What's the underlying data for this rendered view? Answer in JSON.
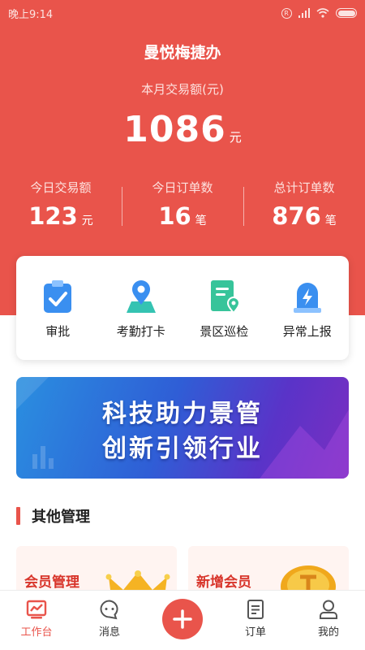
{
  "status_bar": {
    "time": "晚上9:14"
  },
  "header": {
    "store_name": "曼悦梅捷办",
    "month_label": "本月交易额(元)",
    "month_amount": "1086",
    "month_unit": "元"
  },
  "stats": [
    {
      "label": "今日交易额",
      "value": "123",
      "unit": "元"
    },
    {
      "label": "今日订单数",
      "value": "16",
      "unit": "笔"
    },
    {
      "label": "总计订单数",
      "value": "876",
      "unit": "笔"
    }
  ],
  "quick_actions": [
    {
      "label": "审批",
      "icon": "clipboard-check-icon"
    },
    {
      "label": "考勤打卡",
      "icon": "location-pin-icon"
    },
    {
      "label": "景区巡检",
      "icon": "document-location-icon"
    },
    {
      "label": "异常上报",
      "icon": "alert-lightning-icon"
    }
  ],
  "banner": {
    "line1": "科技助力景管",
    "line2": "创新引领行业"
  },
  "section": {
    "title": "其他管理"
  },
  "management_cards": [
    {
      "label": "会员管理",
      "icon": "crown-icon"
    },
    {
      "label": "新增会员",
      "icon": "gold-coin-icon"
    }
  ],
  "tabbar": {
    "items": [
      {
        "label": "工作台",
        "icon": "chart-monitor-icon",
        "active": true
      },
      {
        "label": "消息",
        "icon": "chat-bubble-icon",
        "active": false
      },
      {
        "label": "订单",
        "icon": "order-document-icon",
        "active": false
      },
      {
        "label": "我的",
        "icon": "user-profile-icon",
        "active": false
      }
    ],
    "center_icon": "plus-icon"
  },
  "colors": {
    "primary": "#e9544b",
    "accent_blue": "#3a8ff0",
    "accent_green": "#37c49a"
  }
}
